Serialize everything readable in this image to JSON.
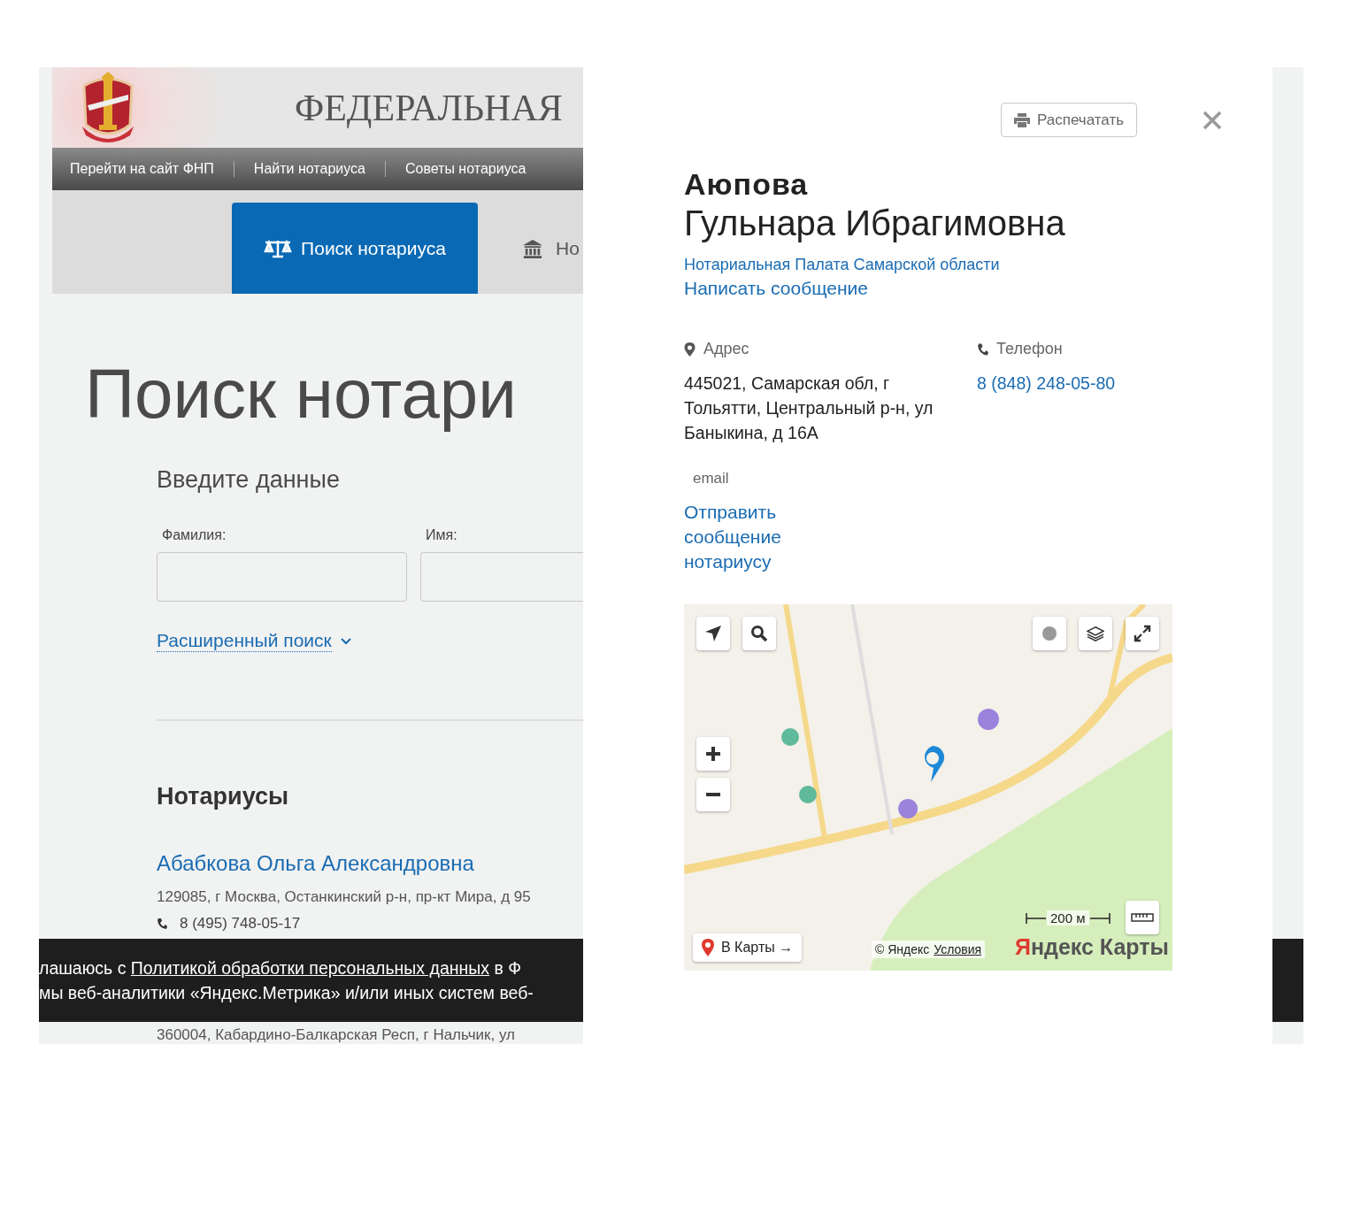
{
  "header": {
    "title": "ФЕДЕРАЛЬНАЯ"
  },
  "top_nav": [
    "Перейти на сайт ФНП",
    "Найти нотариуса",
    "Советы нотариуса"
  ],
  "tabs": [
    {
      "label": "Поиск нотариуса",
      "selected": true
    },
    {
      "label": "Но",
      "selected": false
    }
  ],
  "page_title": "Поиск нотари",
  "form": {
    "heading": "Введите данные",
    "fields": [
      {
        "label": "Фамилия:"
      },
      {
        "label": "Имя:"
      }
    ],
    "advanced_link": "Расширенный поиск"
  },
  "results": {
    "heading": "Нотариусы",
    "items": [
      {
        "name": "Абабкова Ольга Александровна",
        "address": "129085, г Москва, Останкинский р-н, пр-кт Мира, д 95",
        "phone": "8 (495) 748-05-17"
      },
      {
        "address": "360004, Кабардино-Балкарская Респ, г Нальчик, ул"
      }
    ]
  },
  "cookie_banner": {
    "lines": [
      [
        {
          "text": "лашаюсь с ",
          "link": false
        },
        {
          "text": "Политикой обработки персональных данных",
          "link": true
        },
        {
          "text": " в Ф",
          "link": false
        }
      ],
      [
        {
          "text": "мы веб-аналитики «Яндекс.Метрика» и/или иных систем веб-",
          "link": false
        }
      ]
    ]
  },
  "modal": {
    "print_button": "Распечатать",
    "surname": "Аюпова",
    "given_names": "Гульнара Ибрагимовна",
    "chamber_link": "Нотариальная Палата Самарской области",
    "message_link": "Написать сообщение",
    "address": {
      "label": "Адрес",
      "value": "445021, Самарская обл, г Тольятти, Центральный р-н, ул Баныкина, д 16А"
    },
    "phone": {
      "label": "Телефон",
      "value": "8 (848) 248-05-80"
    },
    "email": {
      "label": "email",
      "link": "Отправить сообщение нотариусу"
    },
    "map": {
      "open_button": "В Карты →",
      "scale": "200 м",
      "copyright": "© Яндекс",
      "terms_link": "Условия",
      "logo_first": "Я",
      "logo_rest": "ндекс Карты"
    }
  }
}
